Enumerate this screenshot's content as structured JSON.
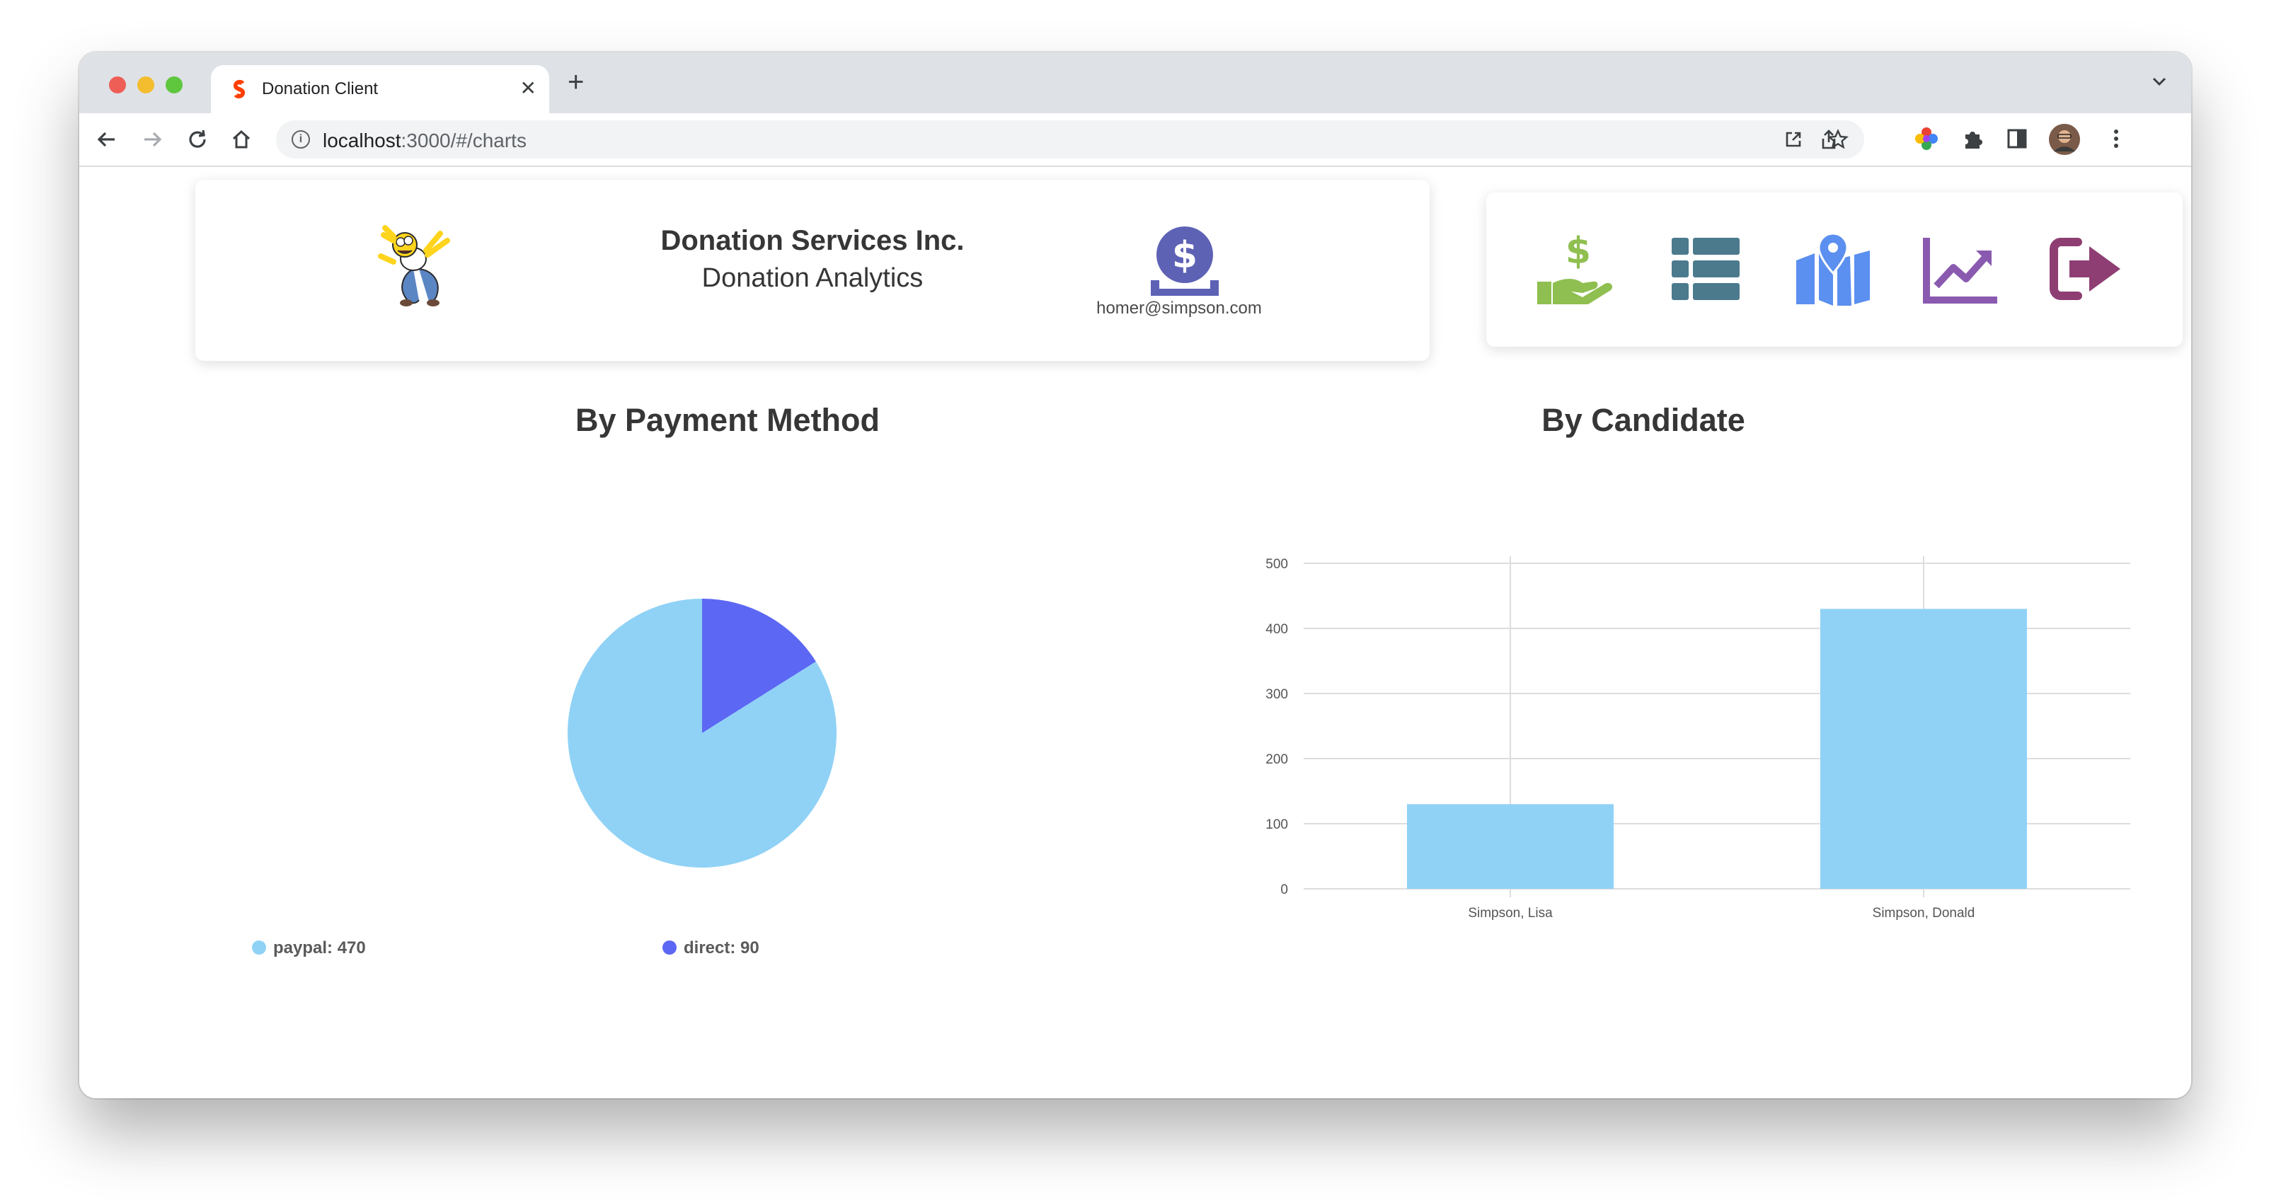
{
  "browser": {
    "tab_title": "Donation Client",
    "url_host": "localhost",
    "url_path": ":3000/#/charts"
  },
  "header": {
    "org_name": "Donation Services Inc.",
    "subtitle": "Donation Analytics",
    "user_email": "homer@simpson.com"
  },
  "nav": {
    "items": [
      {
        "icon": "donate-icon",
        "color": "#8fbf50"
      },
      {
        "icon": "list-icon",
        "color": "#4b7a8d"
      },
      {
        "icon": "map-icon",
        "color": "#5b8ff0"
      },
      {
        "icon": "chart-line-icon",
        "color": "#8a5ab0"
      },
      {
        "icon": "logout-icon",
        "color": "#8e3e72"
      }
    ]
  },
  "chart_data": [
    {
      "type": "pie",
      "title": "By Payment Method",
      "labels": [
        "paypal",
        "direct"
      ],
      "values": [
        470,
        90
      ],
      "legend_text": [
        "paypal: 470",
        "direct: 90"
      ],
      "colors": [
        "#90d2f6",
        "#5c67f3"
      ],
      "legend": "bottom"
    },
    {
      "type": "bar",
      "title": "By Candidate",
      "categories": [
        "Simpson, Lisa",
        "Simpson, Donald"
      ],
      "values": [
        130,
        430
      ],
      "ylim": [
        0,
        500
      ],
      "yticks": [
        "0",
        "100",
        "200",
        "300",
        "400",
        "500"
      ],
      "color": "#90d2f6",
      "grid": true
    }
  ]
}
